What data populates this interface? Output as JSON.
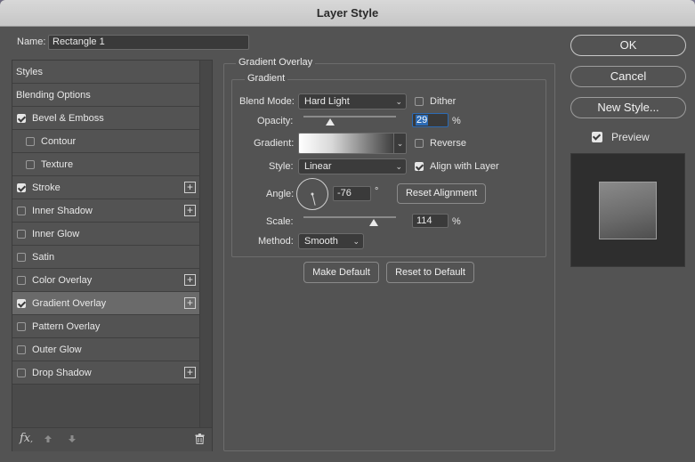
{
  "window": {
    "title": "Layer Style"
  },
  "name_field": {
    "label": "Name:",
    "value": "Rectangle 1"
  },
  "sidebar": {
    "items": [
      {
        "label": "Styles",
        "checkbox": false,
        "checked": false,
        "plus": false,
        "indent": false,
        "selected": false
      },
      {
        "label": "Blending Options",
        "checkbox": false,
        "checked": false,
        "plus": false,
        "indent": false,
        "selected": false
      },
      {
        "label": "Bevel & Emboss",
        "checkbox": true,
        "checked": true,
        "plus": false,
        "indent": false,
        "selected": false
      },
      {
        "label": "Contour",
        "checkbox": true,
        "checked": false,
        "plus": false,
        "indent": true,
        "selected": false
      },
      {
        "label": "Texture",
        "checkbox": true,
        "checked": false,
        "plus": false,
        "indent": true,
        "selected": false
      },
      {
        "label": "Stroke",
        "checkbox": true,
        "checked": true,
        "plus": true,
        "indent": false,
        "selected": false
      },
      {
        "label": "Inner Shadow",
        "checkbox": true,
        "checked": false,
        "plus": true,
        "indent": false,
        "selected": false
      },
      {
        "label": "Inner Glow",
        "checkbox": true,
        "checked": false,
        "plus": false,
        "indent": false,
        "selected": false
      },
      {
        "label": "Satin",
        "checkbox": true,
        "checked": false,
        "plus": false,
        "indent": false,
        "selected": false
      },
      {
        "label": "Color Overlay",
        "checkbox": true,
        "checked": false,
        "plus": true,
        "indent": false,
        "selected": false
      },
      {
        "label": "Gradient Overlay",
        "checkbox": true,
        "checked": true,
        "plus": true,
        "indent": false,
        "selected": true
      },
      {
        "label": "Pattern Overlay",
        "checkbox": true,
        "checked": false,
        "plus": false,
        "indent": false,
        "selected": false
      },
      {
        "label": "Outer Glow",
        "checkbox": true,
        "checked": false,
        "plus": false,
        "indent": false,
        "selected": false
      },
      {
        "label": "Drop Shadow",
        "checkbox": true,
        "checked": false,
        "plus": true,
        "indent": false,
        "selected": false
      }
    ],
    "footer": {
      "fx_label": "fx",
      "fx_suffix": ","
    }
  },
  "panel": {
    "outer_title": "Gradient Overlay",
    "inner_title": "Gradient",
    "blend_mode": {
      "label": "Blend Mode:",
      "value": "Hard Light"
    },
    "dither": {
      "label": "Dither",
      "checked": false
    },
    "opacity": {
      "label": "Opacity:",
      "value": "29",
      "unit": "%",
      "level": 0.29
    },
    "gradient": {
      "label": "Gradient:"
    },
    "reverse": {
      "label": "Reverse",
      "checked": false
    },
    "style": {
      "label": "Style:",
      "value": "Linear"
    },
    "align_with_layer": {
      "label": "Align with Layer",
      "checked": true
    },
    "angle": {
      "label": "Angle:",
      "value": "-76",
      "unit": "°",
      "degrees": -76
    },
    "reset_alignment": "Reset Alignment",
    "scale": {
      "label": "Scale:",
      "value": "114",
      "unit": "%",
      "level": 0.76
    },
    "method": {
      "label": "Method:",
      "value": "Smooth"
    },
    "make_default": "Make Default",
    "reset_to_default": "Reset to Default"
  },
  "right": {
    "ok": "OK",
    "cancel": "Cancel",
    "new_style": "New Style...",
    "preview": {
      "label": "Preview",
      "checked": true
    }
  },
  "colors": {
    "dialog_bg": "#535353",
    "selected_row": "#6a6a6a",
    "highlight": "#2c6bb5"
  }
}
